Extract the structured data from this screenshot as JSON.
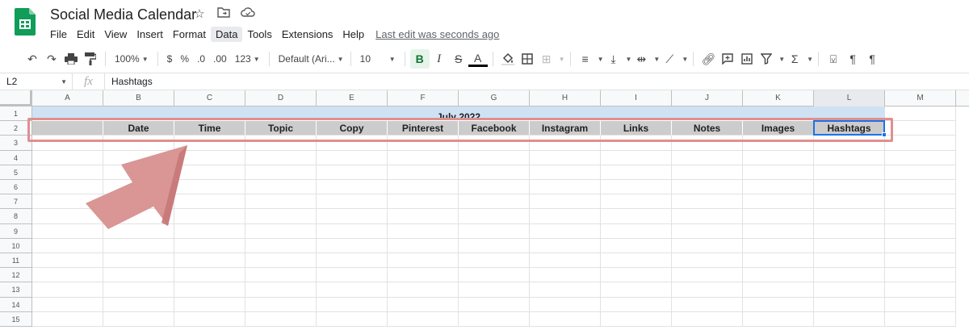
{
  "app": {
    "doc_title": "Social Media Calendar",
    "logo_icon": "sheets-logo-icon",
    "brand_color": "#0f9d58"
  },
  "menu": [
    "File",
    "Edit",
    "View",
    "Insert",
    "Format",
    "Data",
    "Tools",
    "Extensions",
    "Help"
  ],
  "active_menu": "Data",
  "last_edit": "Last edit was seconds ago",
  "toolbar": {
    "zoom": "100%",
    "currency": "$",
    "percent": "%",
    "dec_decrease": ".0",
    "dec_increase": ".00",
    "more_formats": "123",
    "font": "Default (Ari...",
    "font_size": "10",
    "bold": "B",
    "italic": "I",
    "strike": "S",
    "text_color": "A"
  },
  "formula_bar": {
    "cell_ref": "L2",
    "fx": "fx",
    "content": "Hashtags"
  },
  "columns": [
    "A",
    "B",
    "C",
    "D",
    "E",
    "F",
    "G",
    "H",
    "I",
    "J",
    "K",
    "L",
    "M"
  ],
  "rows": [
    "1",
    "2",
    "3",
    "4",
    "5",
    "6",
    "7",
    "8",
    "9",
    "10",
    "11",
    "12",
    "13",
    "14",
    "15"
  ],
  "sheet": {
    "row1_title": "July 2022",
    "row2_headers": [
      "",
      "Date",
      "Time",
      "Topic",
      "Copy",
      "Pinterest",
      "Facebook",
      "Instagram",
      "Links",
      "Notes",
      "Images",
      "Hashtags"
    ]
  },
  "colors": {
    "header_fill": "#cccccc",
    "title_fill": "#cfe2f3",
    "highlight": "#e08f8f",
    "selection": "#1a73e8"
  }
}
